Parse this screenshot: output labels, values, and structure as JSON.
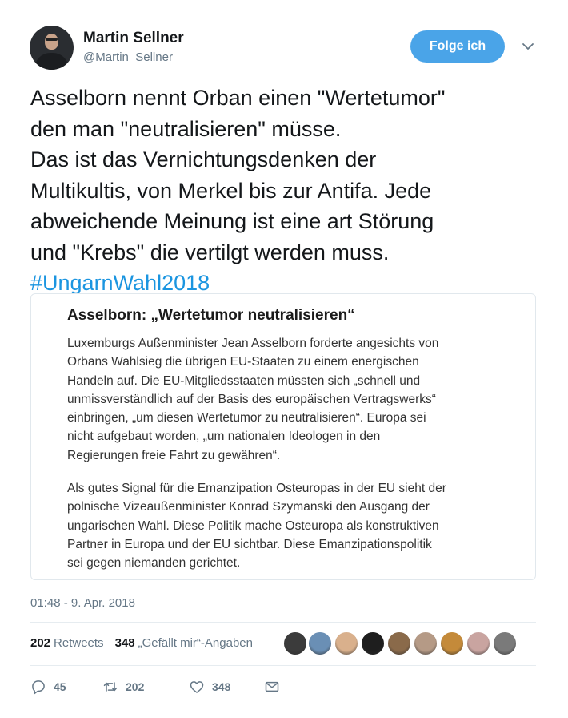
{
  "author": {
    "name": "Martin Sellner",
    "handle": "@Martin_Sellner"
  },
  "follow_button": {
    "label": "Folge ich"
  },
  "tweet": {
    "lines": [
      "Asselborn nennt Orban einen \"Wertetumor\"",
      "den man \"neutralisieren\" müsse.",
      "Das ist das Vernichtungsdenken der",
      "Multikultis, von Merkel bis zur Antifa. Jede",
      "abweichende Meinung ist eine art Störung",
      "und \"Krebs\" die vertilgt werden muss."
    ],
    "hashtag": "#UngarnWahl2018"
  },
  "card": {
    "title": "Asselborn: „Wertetumor neutralisieren“",
    "para1": [
      "Luxemburgs Außenminister Jean Asselborn forderte angesichts von",
      "Orbans Wahlsieg die übrigen EU-Staaten zu einem energischen",
      "Handeln auf. Die EU-Mitgliedsstaaten müssten sich „schnell und",
      "unmissverständlich auf der Basis des europäischen Vertragswerks“",
      "einbringen, „um diesen Wertetumor zu neutralisieren“. Europa sei",
      "nicht aufgebaut worden, „um nationalen Ideologen in den",
      "Regierungen freie Fahrt zu gewähren“."
    ],
    "para2": [
      "Als gutes Signal für die Emanzipation Osteuropas in der EU sieht der",
      "polnische Vizeaußenminister Konrad Szymanski den Ausgang der",
      "ungarischen Wahl. Diese Politik mache Osteuropa als konstruktiven",
      "Partner in Europa und der EU sichtbar. Diese Emanzipationspolitik",
      "sei gegen niemanden gerichtet."
    ]
  },
  "timestamp": "01:48 - 9. Apr. 2018",
  "stats": {
    "retweets_count": "202",
    "retweets_label": "Retweets",
    "likes_count": "348",
    "likes_label": "„Gefällt mir“-Angaben"
  },
  "liker_avatars": [
    "#3b3b3b",
    "#6a8fb5",
    "#d9b08c",
    "#1e1e1e",
    "#8a6a4a",
    "#b59a86",
    "#c48a3a",
    "#c9a4a0",
    "#7a7a7a"
  ],
  "actions": {
    "replies": "45",
    "retweets": "202",
    "likes": "348"
  },
  "colors": {
    "accent": "#1b95e0",
    "follow_bg": "#4aa4e8",
    "secondary_text": "#657786"
  }
}
